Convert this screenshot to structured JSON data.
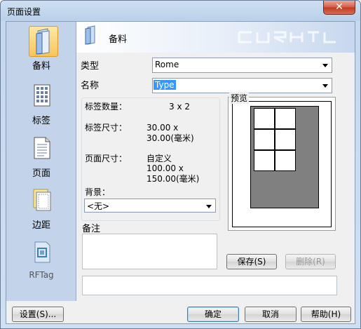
{
  "window": {
    "title": "页面设置",
    "close_glyph": "✕"
  },
  "sidebar": {
    "items": [
      {
        "label": "备料",
        "icon": "folder-icon"
      },
      {
        "label": "标签",
        "icon": "grid-icon"
      },
      {
        "label": "页面",
        "icon": "page-icon"
      },
      {
        "label": "边距",
        "icon": "margin-icon"
      },
      {
        "label": "RFTag",
        "icon": "rftag-icon"
      }
    ]
  },
  "banner": {
    "title": "备料"
  },
  "form": {
    "type_label": "类型",
    "type_value": "Rome",
    "name_label": "名称",
    "name_value": "Type",
    "label_count_label": "标签数量：",
    "label_count_value": "3 x 2",
    "label_size_label": "标签尺寸：",
    "label_size_value": "30.00 x 30.00(毫米)",
    "page_size_label": "页面尺寸：",
    "page_size_line1": "自定义",
    "page_size_line2": "100.00 x 150.00(毫米)",
    "background_label": "背景：",
    "background_value": "<无>",
    "preview_label": "预览",
    "notes_label": "备注"
  },
  "buttons": {
    "save": "保存(S)",
    "delete": "删除(R)",
    "settings": "设置(S)...",
    "ok": "确定",
    "cancel": "取消",
    "help": "帮助(H)"
  },
  "preview": {
    "columns": 2,
    "rows": 3
  }
}
